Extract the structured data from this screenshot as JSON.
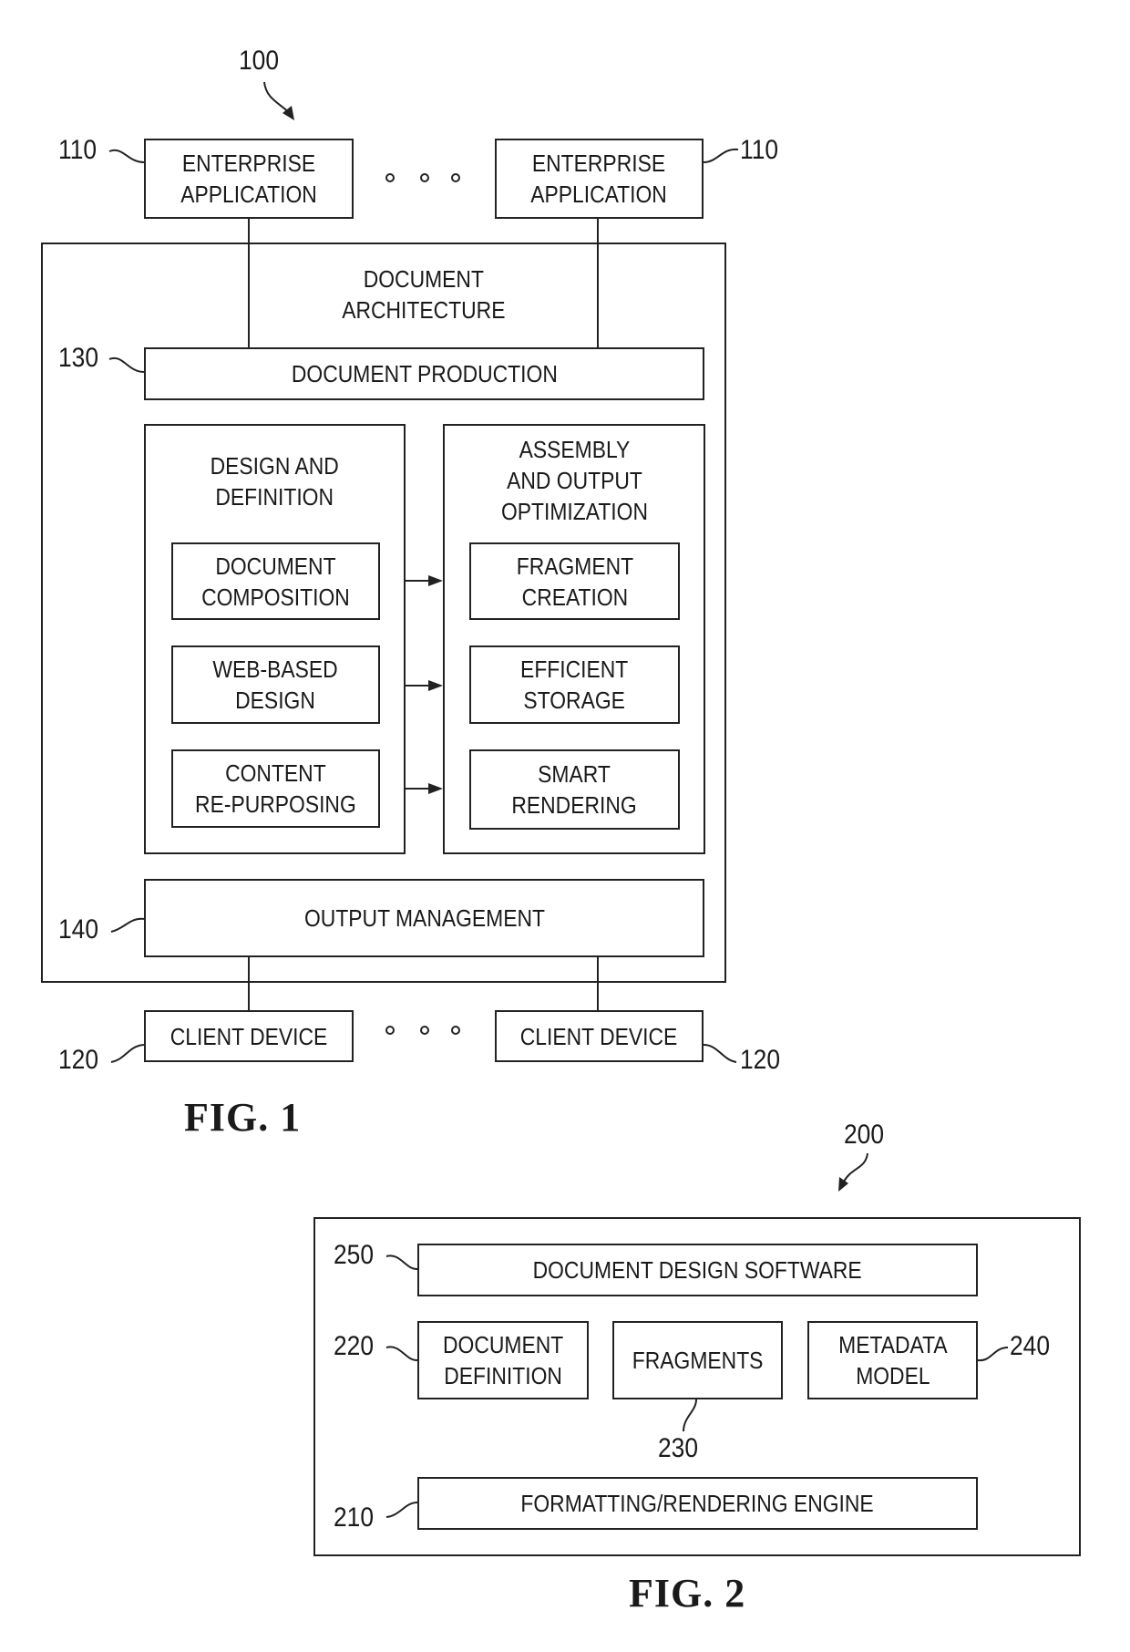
{
  "fig1": {
    "caption": "FIG. 1",
    "ref_system": "100",
    "enterprise_apps": [
      {
        "ref": "110",
        "label": "ENTERPRISE\nAPPLICATION"
      },
      {
        "ref": "110",
        "label": "ENTERPRISE\nAPPLICATION"
      }
    ],
    "ellipsis_top": "◦ ◦ ◦",
    "architecture_label": "DOCUMENT\nARCHITECTURE",
    "document_production": {
      "ref": "130",
      "label": "DOCUMENT PRODUCTION"
    },
    "design_definition": {
      "title": "DESIGN AND\nDEFINITION",
      "items": [
        {
          "label": "DOCUMENT\nCOMPOSITION"
        },
        {
          "label": "WEB-BASED\nDESIGN"
        },
        {
          "label": "CONTENT\nRE-PURPOSING"
        }
      ]
    },
    "assembly_output": {
      "title": "ASSEMBLY\nAND OUTPUT\nOPTIMIZATION",
      "items": [
        {
          "label": "FRAGMENT\nCREATION"
        },
        {
          "label": "EFFICIENT\nSTORAGE"
        },
        {
          "label": "SMART\nRENDERING"
        }
      ]
    },
    "output_management": {
      "ref": "140",
      "label": "OUTPUT MANAGEMENT"
    },
    "client_devices": [
      {
        "ref": "120",
        "label": "CLIENT DEVICE"
      },
      {
        "ref": "120",
        "label": "CLIENT DEVICE"
      }
    ]
  },
  "fig2": {
    "caption": "FIG. 2",
    "ref_system": "200",
    "design_software": {
      "ref": "250",
      "label": "DOCUMENT DESIGN SOFTWARE"
    },
    "document_definition": {
      "ref": "220",
      "label": "DOCUMENT\nDEFINITION"
    },
    "fragments": {
      "ref": "230",
      "label": "FRAGMENTS"
    },
    "metadata_model": {
      "ref": "240",
      "label": "METADATA\nMODEL"
    },
    "rendering_engine": {
      "ref": "210",
      "label": "FORMATTING/RENDERING ENGINE"
    }
  }
}
